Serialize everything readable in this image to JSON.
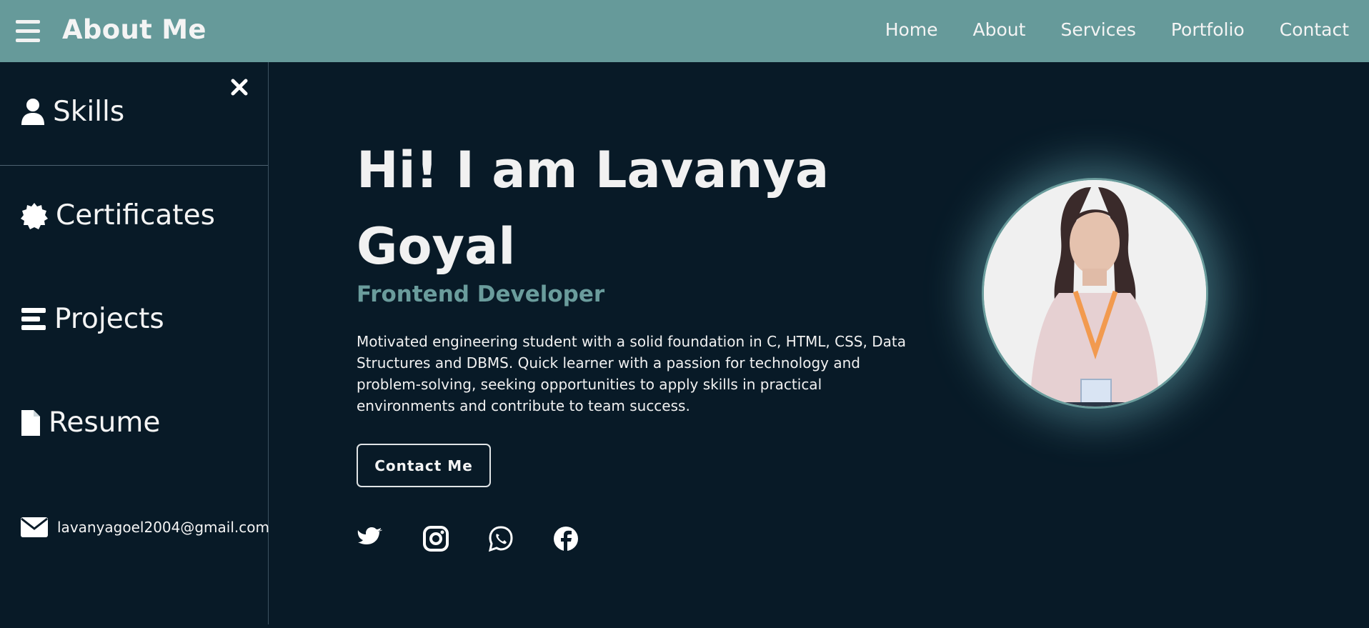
{
  "header": {
    "brand": "About Me",
    "nav": [
      "Home",
      "About",
      "Services",
      "Portfolio",
      "Contact"
    ]
  },
  "sidebar": {
    "items": [
      {
        "label": "Skills",
        "icon": "user-icon"
      },
      {
        "label": "Certificates",
        "icon": "badge-icon"
      },
      {
        "label": "Projects",
        "icon": "bars-icon"
      },
      {
        "label": "Resume",
        "icon": "file-icon"
      }
    ],
    "email": "lavanyagoel2004@gmail.com"
  },
  "hero": {
    "title": "Hi! I am Lavanya Goyal",
    "role": "Frontend Developer",
    "description": "Motivated engineering student with a solid foundation in C, HTML, CSS, Data Structures and DBMS. Quick learner with a passion for technology and problem-solving, seeking opportunities to apply skills in practical environments and contribute to team success.",
    "button": "Contact Me",
    "socials": [
      "twitter-icon",
      "instagram-icon",
      "whatsapp-icon",
      "facebook-icon"
    ]
  },
  "colors": {
    "header_bg": "#669a9a",
    "page_bg": "#081a27",
    "accent": "#6a9c9c"
  }
}
